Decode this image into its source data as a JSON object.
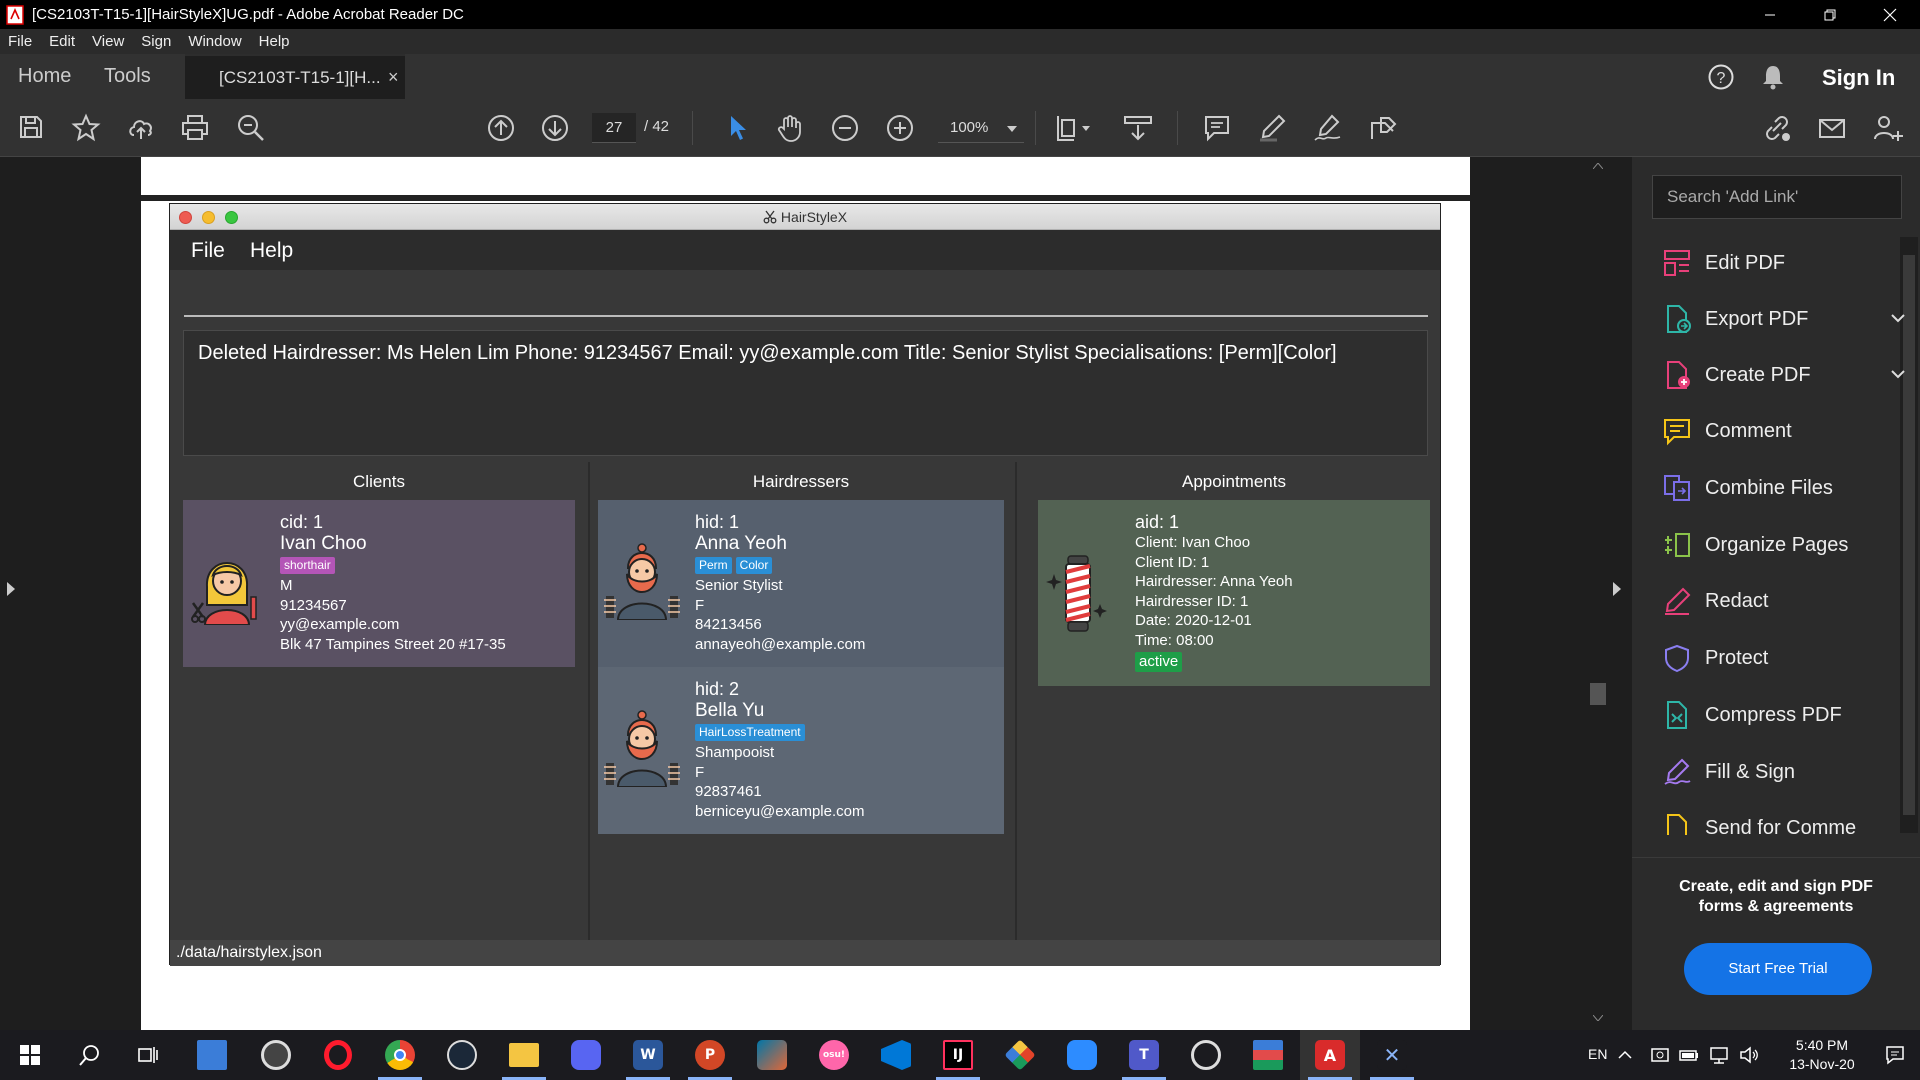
{
  "window": {
    "title": "[CS2103T-T15-1][HairStyleX]UG.pdf - Adobe Acrobat Reader DC"
  },
  "menubar": [
    "File",
    "Edit",
    "View",
    "Sign",
    "Window",
    "Help"
  ],
  "tabs": {
    "home": "Home",
    "tools": "Tools",
    "doc": "[CS2103T-T15-1][H...",
    "close": "×",
    "sign_in": "Sign In"
  },
  "toolbar": {
    "page_current": "27",
    "page_total": "/  42",
    "zoom": "100%"
  },
  "app": {
    "title": "HairStyleX",
    "menu": [
      "File",
      "Help"
    ],
    "result": "Deleted Hairdresser: Ms Helen Lim Phone: 91234567 Email: yy@example.com Title: Senior Stylist Specialisations: [Perm][Color]",
    "panels": [
      "Clients",
      "Hairdressers",
      "Appointments"
    ],
    "clients": [
      {
        "id": "cid: 1",
        "name": "Ivan Choo",
        "tags": [
          "shorthair"
        ],
        "gender": "M",
        "phone": "91234567",
        "email": "yy@example.com",
        "address": "Blk 47 Tampines Street 20 #17-35"
      }
    ],
    "hairdressers": [
      {
        "id": "hid: 1",
        "name": "Anna Yeoh",
        "tags": [
          "Perm",
          "Color"
        ],
        "title": "Senior Stylist",
        "gender": "F",
        "phone": "84213456",
        "email": "annayeoh@example.com"
      },
      {
        "id": "hid: 2",
        "name": "Bella Yu",
        "tags": [
          "HairLossTreatment"
        ],
        "title": "Shampooist",
        "gender": "F",
        "phone": "92837461",
        "email": "berniceyu@example.com"
      }
    ],
    "appointments": [
      {
        "id": "aid: 1",
        "client": "Client: Ivan Choo",
        "client_id": "Client ID: 1",
        "hairdresser": "Hairdresser: Anna Yeoh",
        "hairdresser_id": "Hairdresser ID: 1",
        "date": "Date: 2020-12-01",
        "time": "Time: 08:00",
        "status": "active"
      }
    ],
    "status_path": "./data/hairstylex.json"
  },
  "rightpane": {
    "search_placeholder": "Search 'Add Link'",
    "tools": [
      {
        "label": "Edit PDF",
        "icon": "edit-pdf-icon"
      },
      {
        "label": "Export PDF",
        "icon": "export-pdf-icon"
      },
      {
        "label": "Create PDF",
        "icon": "create-pdf-icon"
      },
      {
        "label": "Comment",
        "icon": "comment-icon"
      },
      {
        "label": "Combine Files",
        "icon": "combine-files-icon"
      },
      {
        "label": "Organize Pages",
        "icon": "organize-pages-icon"
      },
      {
        "label": "Redact",
        "icon": "redact-icon"
      },
      {
        "label": "Protect",
        "icon": "protect-icon"
      },
      {
        "label": "Compress PDF",
        "icon": "compress-pdf-icon"
      },
      {
        "label": "Fill & Sign",
        "icon": "fill-sign-icon"
      },
      {
        "label": "Send for Comme",
        "icon": "send-for-comment-icon"
      }
    ],
    "promo": "Create, edit and sign PDF forms & agreements",
    "trial_button": "Start Free Trial"
  },
  "taskbar": {
    "lang": "EN",
    "time": "5:40 PM",
    "date": "13-Nov-20"
  },
  "colors": {
    "client_card": "#5a5163",
    "hairdresser_card": "#56606e",
    "appointment_card": "#536253",
    "accent_blue": "#1473e6"
  }
}
